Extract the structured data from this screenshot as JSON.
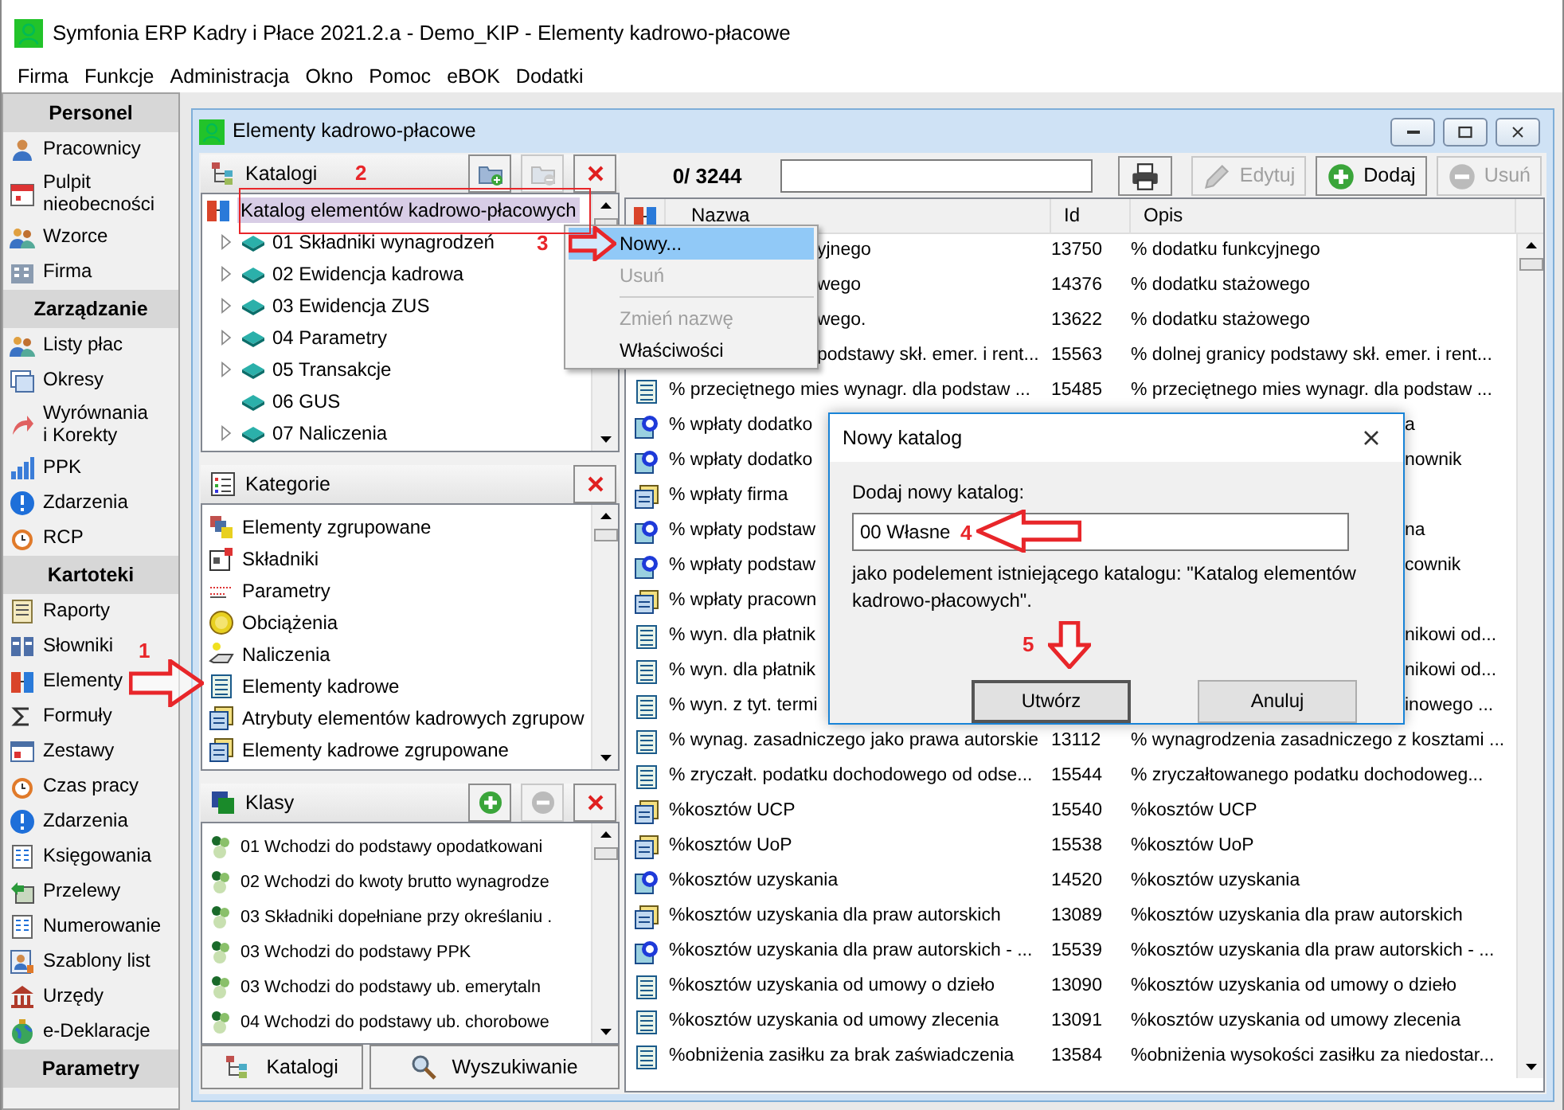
{
  "window": {
    "title": "Symfonia ERP Kadry i Płace 2021.2.a - Demo_KIP - Elementy kadrowo-płacowe"
  },
  "menu": [
    "Firma",
    "Funkcje",
    "Administracja",
    "Okno",
    "Pomoc",
    "eBOK",
    "Dodatki"
  ],
  "sidebar": {
    "sections": [
      {
        "title": "Personel",
        "items": [
          {
            "label": "Pracownicy"
          },
          {
            "label": "Pulpit\nnieobecności"
          },
          {
            "label": "Wzorce"
          },
          {
            "label": "Firma"
          }
        ]
      },
      {
        "title": "Zarządzanie",
        "items": [
          {
            "label": "Listy płac"
          },
          {
            "label": "Okresy"
          },
          {
            "label": "Wyrównania\ni Korekty"
          },
          {
            "label": "PPK"
          },
          {
            "label": "Zdarzenia"
          },
          {
            "label": "RCP"
          }
        ]
      },
      {
        "title": "Kartoteki",
        "items": [
          {
            "label": "Raporty"
          },
          {
            "label": "Słowniki"
          },
          {
            "label": "Elementy"
          },
          {
            "label": "Formuły"
          },
          {
            "label": "Zestawy"
          },
          {
            "label": "Czas pracy"
          },
          {
            "label": "Zdarzenia"
          },
          {
            "label": "Księgowania"
          },
          {
            "label": "Przelewy"
          },
          {
            "label": "Numerowanie"
          },
          {
            "label": "Szablony list"
          },
          {
            "label": "Urzędy"
          },
          {
            "label": "e-Deklaracje"
          }
        ]
      },
      {
        "title": "Parametry"
      }
    ]
  },
  "child_window": {
    "title": "Elementy kadrowo-płacowe"
  },
  "katalogi": {
    "title": "Katalogi",
    "tools": [
      {
        "kind": "folder_add",
        "disabled": false
      },
      {
        "kind": "folder_remove",
        "disabled": true
      },
      {
        "kind": "close",
        "disabled": false
      }
    ],
    "tree": {
      "label": "Katalog elementów kadrowo-płacowych",
      "selected": true,
      "children": [
        {
          "label": "01 Składniki wynagrodzeń",
          "expandable": true
        },
        {
          "label": "02 Ewidencja kadrowa",
          "expandable": true
        },
        {
          "label": "03 Ewidencja ZUS",
          "expandable": true
        },
        {
          "label": "04 Parametry",
          "expandable": true
        },
        {
          "label": "05 Transakcje",
          "expandable": true
        },
        {
          "label": "06 GUS",
          "expandable": false
        },
        {
          "label": "07 Naliczenia",
          "expandable": true
        }
      ]
    }
  },
  "kategorie": {
    "title": "Kategorie",
    "tools": [
      {
        "kind": "close",
        "disabled": false
      }
    ],
    "items": [
      "Elementy zgrupowane",
      "Składniki",
      "Parametry",
      "Obciążenia",
      "Naliczenia",
      "Elementy kadrowe",
      "Atrybuty elementów kadrowych zgrupow",
      "Elementy kadrowe zgrupowane"
    ]
  },
  "klasy": {
    "title": "Klasy",
    "tools": [
      {
        "kind": "plus",
        "disabled": false
      },
      {
        "kind": "minus",
        "disabled": true
      },
      {
        "kind": "close",
        "disabled": false
      }
    ],
    "items": [
      "01 Wchodzi do podstawy opodatkowani",
      "02 Wchodzi do kwoty brutto wynagrodze",
      "03 Składniki dopełniane przy określaniu .",
      "03 Wchodzi do podstawy PPK",
      "03 Wchodzi do podstawy ub. emerytaln",
      "04 Wchodzi do podstawy ub. chorobowe"
    ]
  },
  "bottom_buttons": [
    {
      "label": "Katalogi",
      "kind": "tree"
    },
    {
      "label": "Wyszukiwanie",
      "kind": "search"
    }
  ],
  "toolbar": {
    "counter": "0/ 3244",
    "buttons": [
      {
        "label": "Edytuj",
        "kind": "pencil",
        "disabled": true
      },
      {
        "label": "Dodaj",
        "kind": "plus",
        "disabled": false
      },
      {
        "label": "Usuń",
        "kind": "minus",
        "disabled": true
      }
    ]
  },
  "table": {
    "columns": [
      "Nazwa",
      "Id",
      "Opis"
    ],
    "rows": [
      {
        "kind": "covered",
        "name": "yjnego",
        "id": "13750",
        "opis": "% dodatku funkcyjnego"
      },
      {
        "kind": "covered",
        "name": "wego",
        "id": "14376",
        "opis": "% dodatku stażowego"
      },
      {
        "kind": "covered",
        "name": "wego.",
        "id": "13622",
        "opis": "% dodatku stażowego"
      },
      {
        "kind": "covered",
        "name": "podstawy skł. emer. i rent...",
        "id": "15563",
        "opis": "% dolnej granicy podstawy skł. emer. i rent..."
      },
      {
        "kind": "list",
        "name": "% przeciętnego mies wynagr. dla podstaw ...",
        "id": "15485",
        "opis": "% przeciętnego mies wynagr. dla podstaw ..."
      },
      {
        "kind": "target",
        "name": "% wpłaty dodatko",
        "opis": "a"
      },
      {
        "kind": "target",
        "name": "% wpłaty dodatko",
        "opis": "nownik"
      },
      {
        "kind": "stack",
        "name": "% wpłaty firma"
      },
      {
        "kind": "target",
        "name": "% wpłaty podstaw",
        "opis": "na"
      },
      {
        "kind": "target",
        "name": "% wpłaty podstaw",
        "opis": "cownik"
      },
      {
        "kind": "stack",
        "name": "% wpłaty pracown"
      },
      {
        "kind": "list",
        "name": "% wyn. dla płatnik",
        "opis": "nikowi od..."
      },
      {
        "kind": "list",
        "name": "% wyn. dla płatnik",
        "opis": "nikowi od..."
      },
      {
        "kind": "list",
        "name": "% wyn. z tyt. termi",
        "opis": "inowego ..."
      },
      {
        "kind": "list",
        "name": "% wynag. zasadniczego jako prawa autorskie",
        "id": "13112",
        "opis": "% wynagrodzenia zasadniczego z kosztami ..."
      },
      {
        "kind": "list",
        "name": "% zryczałt. podatku dochodowego od odse...",
        "id": "15544",
        "opis": "% zryczałtowanego podatku dochodoweg..."
      },
      {
        "kind": "stack",
        "name": "%kosztów UCP",
        "id": "15540",
        "opis": "%kosztów UCP"
      },
      {
        "kind": "stack",
        "name": "%kosztów UoP",
        "id": "15538",
        "opis": "%kosztów UoP"
      },
      {
        "kind": "target",
        "name": "%kosztów uzyskania",
        "id": "14520",
        "opis": "%kosztów uzyskania"
      },
      {
        "kind": "stack",
        "name": "%kosztów uzyskania dla praw autorskich",
        "id": "13089",
        "opis": "%kosztów uzyskania dla praw autorskich"
      },
      {
        "kind": "target",
        "name": "%kosztów uzyskania dla praw autorskich - ...",
        "id": "15539",
        "opis": "%kosztów uzyskania dla praw autorskich - ..."
      },
      {
        "kind": "list",
        "name": "%kosztów uzyskania od umowy o dzieło",
        "id": "13090",
        "opis": "%kosztów uzyskania od umowy o dzieło"
      },
      {
        "kind": "list",
        "name": "%kosztów uzyskania od umowy zlecenia",
        "id": "13091",
        "opis": "%kosztów uzyskania od umowy zlecenia"
      },
      {
        "kind": "list",
        "name": "%obniżenia zasiłku za brak zaświadczenia",
        "id": "13584",
        "opis": "%obniżenia wysokości zasiłku za niedostar..."
      }
    ]
  },
  "context_menu": [
    {
      "kind": "item",
      "label": "Nowy...",
      "selected": true,
      "disabled": false
    },
    {
      "kind": "item",
      "label": "Usuń",
      "selected": false,
      "disabled": true
    },
    {
      "kind": "separator"
    },
    {
      "kind": "item",
      "label": "Zmień nazwę",
      "selected": false,
      "disabled": true
    },
    {
      "kind": "item",
      "label": "Właściwości",
      "selected": false,
      "disabled": false
    }
  ],
  "dialog": {
    "title": "Nowy katalog",
    "label": "Dodaj nowy katalog:",
    "value": "00 Własne",
    "note": "jako podelement istniejącego katalogu: \"Katalog elementów kadrowo-płacowych\".",
    "buttons": [
      {
        "label": "Utwórz",
        "default": true
      },
      {
        "label": "Anuluj",
        "default": false
      }
    ]
  },
  "annotations": [
    {
      "kind": "arrow_right",
      "number": "1"
    },
    {
      "kind": "frame",
      "number": "2"
    },
    {
      "kind": "arrow_right",
      "number": "3"
    },
    {
      "kind": "arrow_left",
      "number": "4"
    },
    {
      "kind": "arrow_down",
      "number": "5"
    }
  ]
}
